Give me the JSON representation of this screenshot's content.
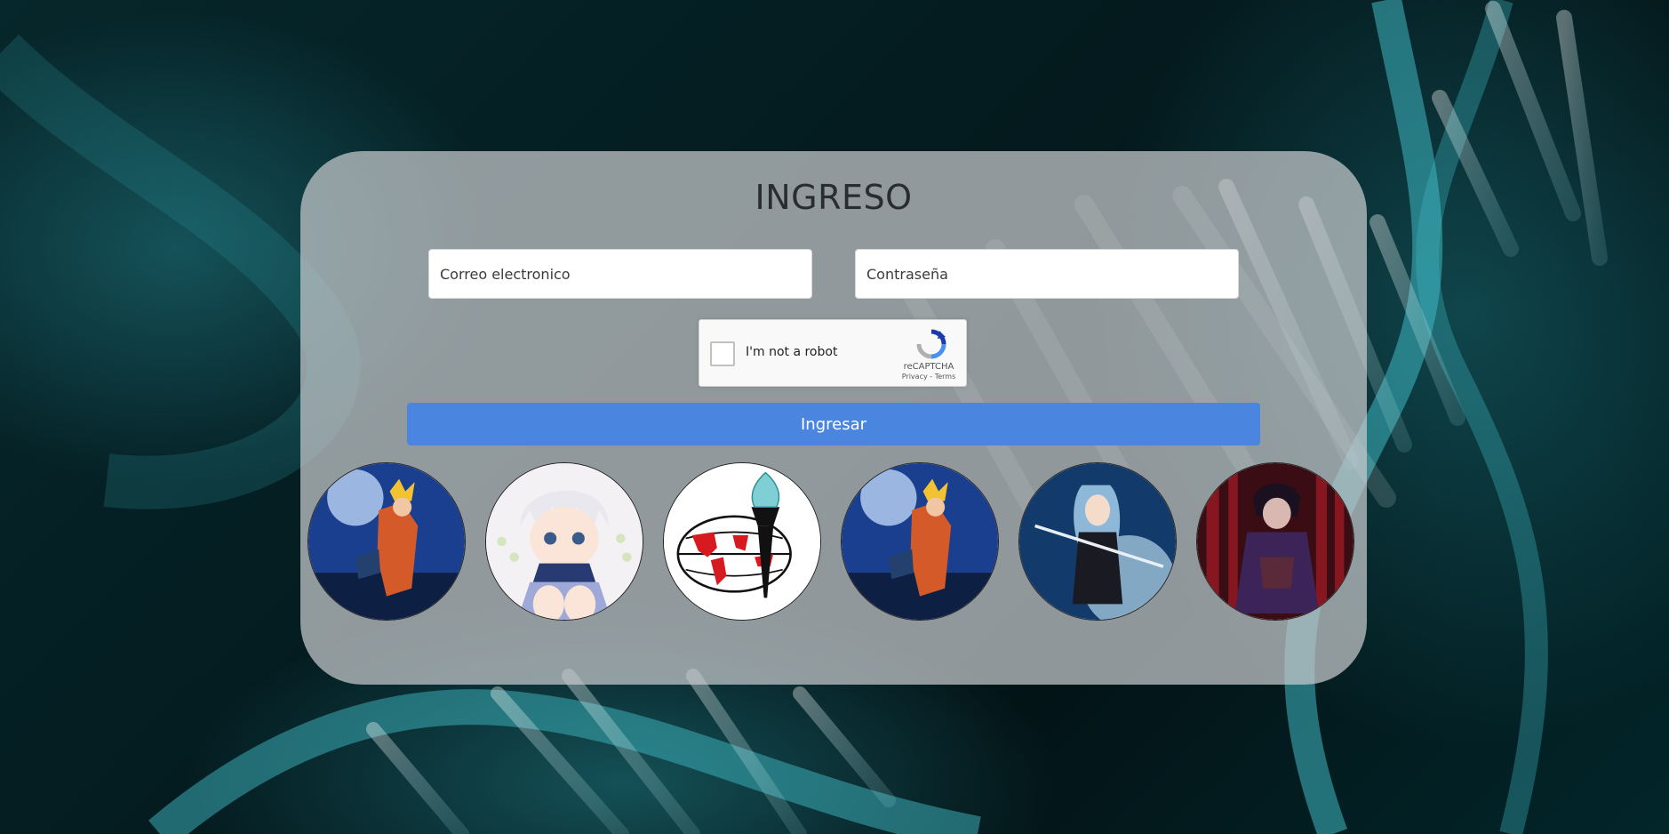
{
  "login": {
    "title": "INGRESO",
    "email_placeholder": "Correo electronico",
    "password_placeholder": "Contraseña",
    "submit_label": "Ingresar"
  },
  "captcha": {
    "label": "I'm not a robot",
    "brand": "reCAPTCHA",
    "privacy": "Privacy",
    "separator": " - ",
    "terms": "Terms",
    "icon": "recaptcha-logo-icon"
  },
  "avatars": [
    {
      "name": "avatar-ninja-blue",
      "icon": "anime-ninja-portrait"
    },
    {
      "name": "avatar-white-hair-boy",
      "icon": "anime-boy-portrait"
    },
    {
      "name": "avatar-institution-logo",
      "icon": "globe-torch-logo"
    },
    {
      "name": "avatar-ninja-blue-2",
      "icon": "anime-ninja-portrait"
    },
    {
      "name": "avatar-swordswoman",
      "icon": "anime-sword-portrait"
    },
    {
      "name": "avatar-dark-red",
      "icon": "anime-dark-portrait"
    }
  ],
  "colors": {
    "background": "#041c20",
    "card": "#c8cbcd",
    "button": "#4a86e0",
    "teal_accent": "#5fd0d8"
  }
}
